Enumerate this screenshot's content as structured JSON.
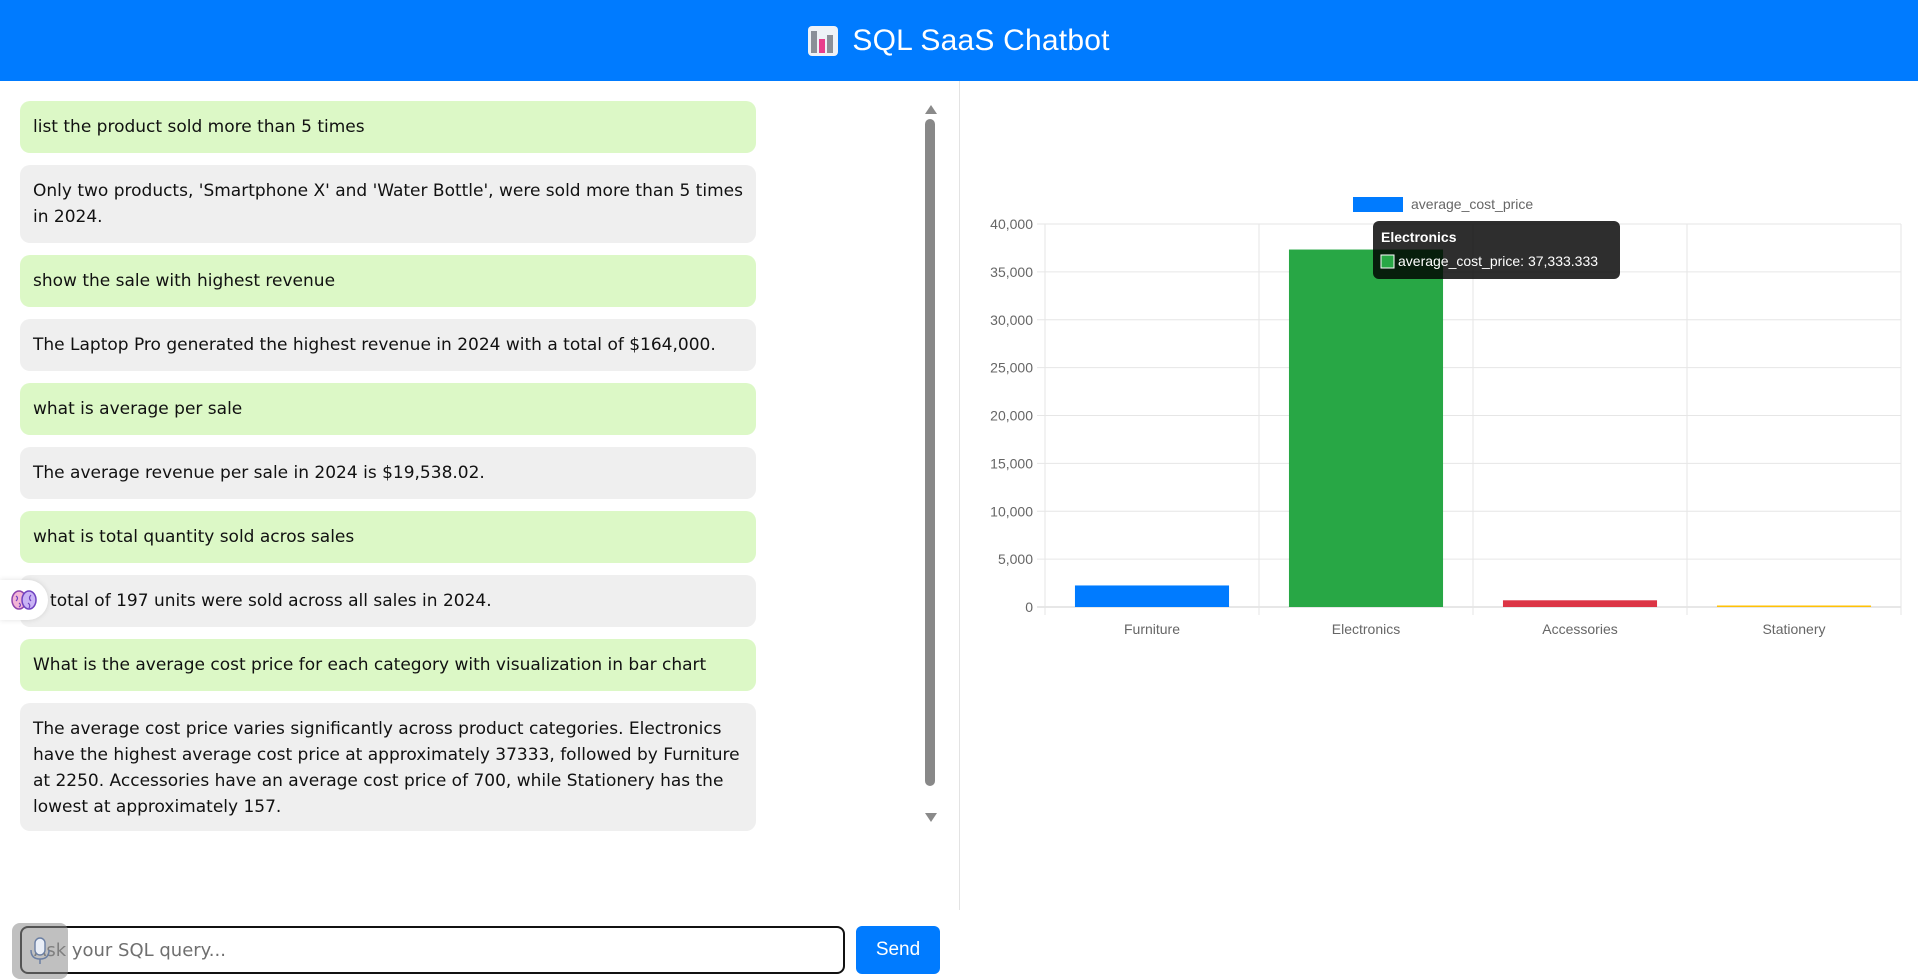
{
  "header": {
    "title": "SQL SaaS Chatbot",
    "icon": "bar-chart-icon"
  },
  "messages": [
    {
      "role": "user",
      "text": "list the product sold more than 5 times"
    },
    {
      "role": "bot",
      "text": "Only two products, 'Smartphone X' and 'Water Bottle', were sold more than 5 times in 2024."
    },
    {
      "role": "user",
      "text": "show the sale with highest revenue"
    },
    {
      "role": "bot",
      "text": "The Laptop Pro generated the highest revenue in 2024 with a total of $164,000."
    },
    {
      "role": "user",
      "text": "what is average per sale"
    },
    {
      "role": "bot",
      "text": "The average revenue per sale in 2024 is $19,538.02."
    },
    {
      "role": "user",
      "text": "what is total quantity sold acros sales"
    },
    {
      "role": "bot",
      "text": "A total of 197 units were sold across all sales in 2024."
    },
    {
      "role": "user",
      "text": "What is the average cost price for each category with visualization in bar chart"
    },
    {
      "role": "bot",
      "text": "The average cost price varies significantly across product categories. Electronics have the highest average cost price at approximately 37333, followed by Furniture at 2250. Accessories have an average cost price of 700, while Stationery has the lowest at approximately 157."
    }
  ],
  "input": {
    "placeholder": "Ask your SQL query...",
    "value": ""
  },
  "send_label": "Send",
  "floating_icon": "brain-icon",
  "colors": {
    "brand": "#007bff",
    "user_bubble": "#dcf8c6",
    "bot_bubble": "#efefef"
  },
  "chart_data": {
    "type": "bar",
    "categories": [
      "Furniture",
      "Electronics",
      "Accessories",
      "Stationery"
    ],
    "series": [
      {
        "name": "average_cost_price",
        "values": [
          2250,
          37333.333,
          700,
          157
        ]
      }
    ],
    "bar_colors": [
      "#007bff",
      "#28a745",
      "#dc3545",
      "#ffc107"
    ],
    "yticks": [
      "0",
      "5,000",
      "10,000",
      "15,000",
      "20,000",
      "25,000",
      "30,000",
      "35,000",
      "40,000"
    ],
    "ylim": [
      0,
      40000
    ],
    "legend": "top",
    "grid": true,
    "tooltip": {
      "title": "Electronics",
      "label": "average_cost_price: 37,333.333"
    }
  }
}
